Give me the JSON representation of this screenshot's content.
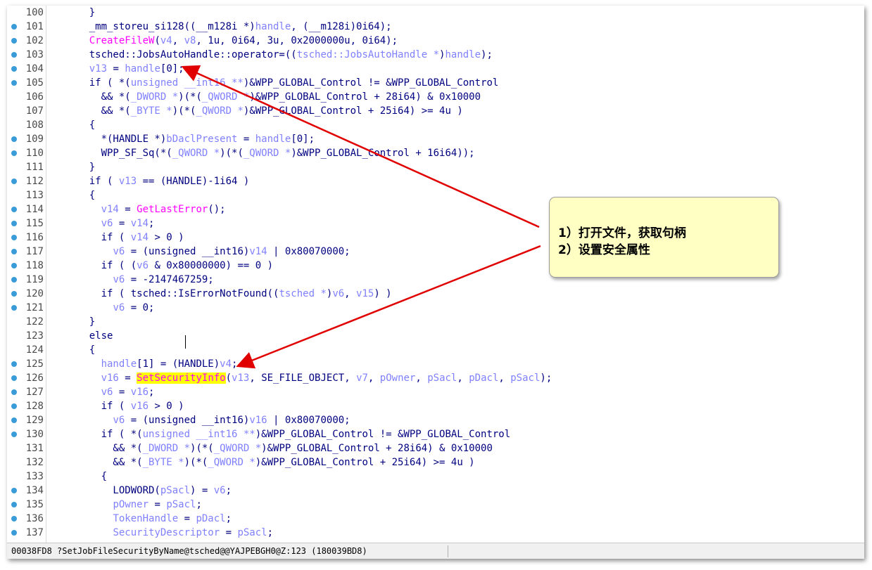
{
  "colors": {
    "keyword": "#000080",
    "var": "#8080ff",
    "call": "#ff00ff",
    "highlight": "#ffff00",
    "arrow": "#e00000",
    "note_bg": "#ffffc4",
    "breakpoint": "#3a9bd9"
  },
  "code_lines": [
    {
      "n": "100",
      "bp": false,
      "s": [
        [
          "    }",
          "k"
        ]
      ]
    },
    {
      "n": "101",
      "bp": true,
      "s": [
        [
          "    _mm_storeu_si128((__m128i *)",
          "k"
        ],
        [
          "handle",
          "v"
        ],
        [
          ", (__m128i)0i64);",
          "k"
        ]
      ]
    },
    {
      "n": "102",
      "bp": true,
      "s": [
        [
          "    ",
          "k"
        ],
        [
          "CreateFileW",
          "c"
        ],
        [
          "(",
          "k"
        ],
        [
          "v4",
          "v"
        ],
        [
          ", ",
          "k"
        ],
        [
          "v8",
          "v"
        ],
        [
          ", 1u, 0i64, 3u, 0x2000000u, 0i64);",
          "k"
        ]
      ]
    },
    {
      "n": "103",
      "bp": true,
      "s": [
        [
          "    tsched::JobsAutoHandle::operator=((",
          "k"
        ],
        [
          "tsched::JobsAutoHandle *",
          "v"
        ],
        [
          ")",
          "k"
        ],
        [
          "handle",
          "v"
        ],
        [
          ");",
          "k"
        ]
      ]
    },
    {
      "n": "104",
      "bp": true,
      "s": [
        [
          "    ",
          "k"
        ],
        [
          "v13",
          "v"
        ],
        [
          " = ",
          "k"
        ],
        [
          "handle",
          "v"
        ],
        [
          "[0];",
          "k"
        ]
      ]
    },
    {
      "n": "105",
      "bp": true,
      "s": [
        [
          "    if ( *(",
          "k"
        ],
        [
          "unsigned __int16 **",
          "v"
        ],
        [
          ")&WPP_GLOBAL_Control != &WPP_GLOBAL_Control",
          "k"
        ]
      ]
    },
    {
      "n": "106",
      "bp": false,
      "s": [
        [
          "      && *(",
          "k"
        ],
        [
          "_DWORD *",
          "v"
        ],
        [
          ")(*(",
          "k"
        ],
        [
          "_QWORD *",
          "v"
        ],
        [
          ")&WPP_GLOBAL_Control + 28i64) & 0x10000",
          "k"
        ]
      ]
    },
    {
      "n": "107",
      "bp": false,
      "s": [
        [
          "      && *(",
          "k"
        ],
        [
          "_BYTE *",
          "v"
        ],
        [
          ")(*(",
          "k"
        ],
        [
          "_QWORD *",
          "v"
        ],
        [
          ")&WPP_GLOBAL_Control + 25i64) >= 4u )",
          "k"
        ]
      ]
    },
    {
      "n": "108",
      "bp": false,
      "s": [
        [
          "    {",
          "k"
        ]
      ]
    },
    {
      "n": "109",
      "bp": true,
      "s": [
        [
          "      *(HANDLE *)",
          "k"
        ],
        [
          "bDaclPresent",
          "v"
        ],
        [
          " = ",
          "k"
        ],
        [
          "handle",
          "v"
        ],
        [
          "[0];",
          "k"
        ]
      ]
    },
    {
      "n": "110",
      "bp": true,
      "s": [
        [
          "      WPP_SF_Sq(*(",
          "k"
        ],
        [
          "_QWORD *",
          "v"
        ],
        [
          ")(*(",
          "k"
        ],
        [
          "_QWORD *",
          "v"
        ],
        [
          ")&WPP_GLOBAL_Control + 16i64));",
          "k"
        ]
      ]
    },
    {
      "n": "111",
      "bp": false,
      "s": [
        [
          "    }",
          "k"
        ]
      ]
    },
    {
      "n": "112",
      "bp": true,
      "s": [
        [
          "    if ( ",
          "k"
        ],
        [
          "v13",
          "v"
        ],
        [
          " == (HANDLE)-1i64 )",
          "k"
        ]
      ]
    },
    {
      "n": "113",
      "bp": false,
      "s": [
        [
          "    {",
          "k"
        ]
      ]
    },
    {
      "n": "114",
      "bp": true,
      "s": [
        [
          "      ",
          "k"
        ],
        [
          "v14",
          "v"
        ],
        [
          " = ",
          "k"
        ],
        [
          "GetLastError",
          "c"
        ],
        [
          "();",
          "k"
        ]
      ]
    },
    {
      "n": "115",
      "bp": true,
      "s": [
        [
          "      ",
          "k"
        ],
        [
          "v6",
          "v"
        ],
        [
          " = ",
          "k"
        ],
        [
          "v14",
          "v"
        ],
        [
          ";",
          "k"
        ]
      ]
    },
    {
      "n": "116",
      "bp": true,
      "s": [
        [
          "      if ( ",
          "k"
        ],
        [
          "v14",
          "v"
        ],
        [
          " > 0 )",
          "k"
        ]
      ]
    },
    {
      "n": "117",
      "bp": true,
      "s": [
        [
          "        ",
          "k"
        ],
        [
          "v6",
          "v"
        ],
        [
          " = (unsigned __int16)",
          "k"
        ],
        [
          "v14",
          "v"
        ],
        [
          " | 0x80070000;",
          "k"
        ]
      ]
    },
    {
      "n": "118",
      "bp": true,
      "s": [
        [
          "      if ( (",
          "k"
        ],
        [
          "v6",
          "v"
        ],
        [
          " & 0x80000000) == 0 )",
          "k"
        ]
      ]
    },
    {
      "n": "119",
      "bp": true,
      "s": [
        [
          "        ",
          "k"
        ],
        [
          "v6",
          "v"
        ],
        [
          " = -2147467259;",
          "k"
        ]
      ]
    },
    {
      "n": "120",
      "bp": true,
      "s": [
        [
          "      if ( tsched::IsErrorNotFound((",
          "k"
        ],
        [
          "tsched *",
          "v"
        ],
        [
          ")",
          "k"
        ],
        [
          "v6",
          "v"
        ],
        [
          ", ",
          "k"
        ],
        [
          "v15",
          "v"
        ],
        [
          ") )",
          "k"
        ]
      ]
    },
    {
      "n": "121",
      "bp": true,
      "s": [
        [
          "        ",
          "k"
        ],
        [
          "v6",
          "v"
        ],
        [
          " = 0;",
          "k"
        ]
      ]
    },
    {
      "n": "122",
      "bp": false,
      "s": [
        [
          "    }",
          "k"
        ]
      ]
    },
    {
      "n": "123",
      "bp": false,
      "s": [
        [
          "    else",
          "k"
        ]
      ]
    },
    {
      "n": "124",
      "bp": false,
      "s": [
        [
          "    {",
          "k"
        ]
      ]
    },
    {
      "n": "125",
      "bp": true,
      "s": [
        [
          "      ",
          "k"
        ],
        [
          "handle",
          "v"
        ],
        [
          "[1] = (HANDLE)",
          "k"
        ],
        [
          "v4",
          "v"
        ],
        [
          ";",
          "k"
        ]
      ]
    },
    {
      "n": "126",
      "bp": true,
      "s": [
        [
          "      ",
          "k"
        ],
        [
          "v16",
          "v"
        ],
        [
          " = ",
          "k"
        ],
        [
          "SetSecurityInfo",
          "h"
        ],
        [
          "(",
          "k"
        ],
        [
          "v13",
          "v"
        ],
        [
          ", SE_FILE_OBJECT, ",
          "k"
        ],
        [
          "v7",
          "v"
        ],
        [
          ", ",
          "k"
        ],
        [
          "pOwner",
          "v"
        ],
        [
          ", ",
          "k"
        ],
        [
          "pSacl",
          "v"
        ],
        [
          ", ",
          "k"
        ],
        [
          "pDacl",
          "v"
        ],
        [
          ", ",
          "k"
        ],
        [
          "pSacl",
          "v"
        ],
        [
          ");",
          "k"
        ]
      ]
    },
    {
      "n": "127",
      "bp": true,
      "s": [
        [
          "      ",
          "k"
        ],
        [
          "v6",
          "v"
        ],
        [
          " = ",
          "k"
        ],
        [
          "v16",
          "v"
        ],
        [
          ";",
          "k"
        ]
      ]
    },
    {
      "n": "128",
      "bp": true,
      "s": [
        [
          "      if ( ",
          "k"
        ],
        [
          "v16",
          "v"
        ],
        [
          " > 0 )",
          "k"
        ]
      ]
    },
    {
      "n": "129",
      "bp": true,
      "s": [
        [
          "        ",
          "k"
        ],
        [
          "v6",
          "v"
        ],
        [
          " = (unsigned __int16)",
          "k"
        ],
        [
          "v16",
          "v"
        ],
        [
          " | 0x80070000;",
          "k"
        ]
      ]
    },
    {
      "n": "130",
      "bp": true,
      "s": [
        [
          "      if ( *(",
          "k"
        ],
        [
          "unsigned __int16 **",
          "v"
        ],
        [
          ")&WPP_GLOBAL_Control != &WPP_GLOBAL_Control",
          "k"
        ]
      ]
    },
    {
      "n": "131",
      "bp": false,
      "s": [
        [
          "        && *(",
          "k"
        ],
        [
          "_DWORD *",
          "v"
        ],
        [
          ")(*(",
          "k"
        ],
        [
          "_QWORD *",
          "v"
        ],
        [
          ")&WPP_GLOBAL_Control + 28i64) & 0x10000",
          "k"
        ]
      ]
    },
    {
      "n": "132",
      "bp": false,
      "s": [
        [
          "        && *(",
          "k"
        ],
        [
          "_BYTE *",
          "v"
        ],
        [
          ")(*(",
          "k"
        ],
        [
          "_QWORD *",
          "v"
        ],
        [
          ")&WPP_GLOBAL_Control + 25i64) >= 4u )",
          "k"
        ]
      ]
    },
    {
      "n": "133",
      "bp": false,
      "s": [
        [
          "      {",
          "k"
        ]
      ]
    },
    {
      "n": "134",
      "bp": true,
      "s": [
        [
          "        LODWORD(",
          "k"
        ],
        [
          "pSacl",
          "v"
        ],
        [
          ") = ",
          "k"
        ],
        [
          "v6",
          "v"
        ],
        [
          ";",
          "k"
        ]
      ]
    },
    {
      "n": "135",
      "bp": true,
      "s": [
        [
          "        ",
          "k"
        ],
        [
          "pOwner",
          "v"
        ],
        [
          " = ",
          "k"
        ],
        [
          "pSacl",
          "v"
        ],
        [
          ";",
          "k"
        ]
      ]
    },
    {
      "n": "136",
      "bp": true,
      "s": [
        [
          "        ",
          "k"
        ],
        [
          "TokenHandle",
          "v"
        ],
        [
          " = ",
          "k"
        ],
        [
          "pDacl",
          "v"
        ],
        [
          ";",
          "k"
        ]
      ]
    },
    {
      "n": "137",
      "bp": true,
      "s": [
        [
          "        ",
          "k"
        ],
        [
          "SecurityDescriptor",
          "v"
        ],
        [
          " = ",
          "k"
        ],
        [
          "pSacl",
          "v"
        ],
        [
          ";",
          "k"
        ]
      ]
    }
  ],
  "status_bar": {
    "text": "00038FD8 ?SetJobFileSecurityByName@tsched@@YAJPEBGH0@Z:123 (180039BD8)"
  },
  "annotation": {
    "line1": "1）打开文件，获取句柄",
    "line2": "2）设置安全属性"
  }
}
